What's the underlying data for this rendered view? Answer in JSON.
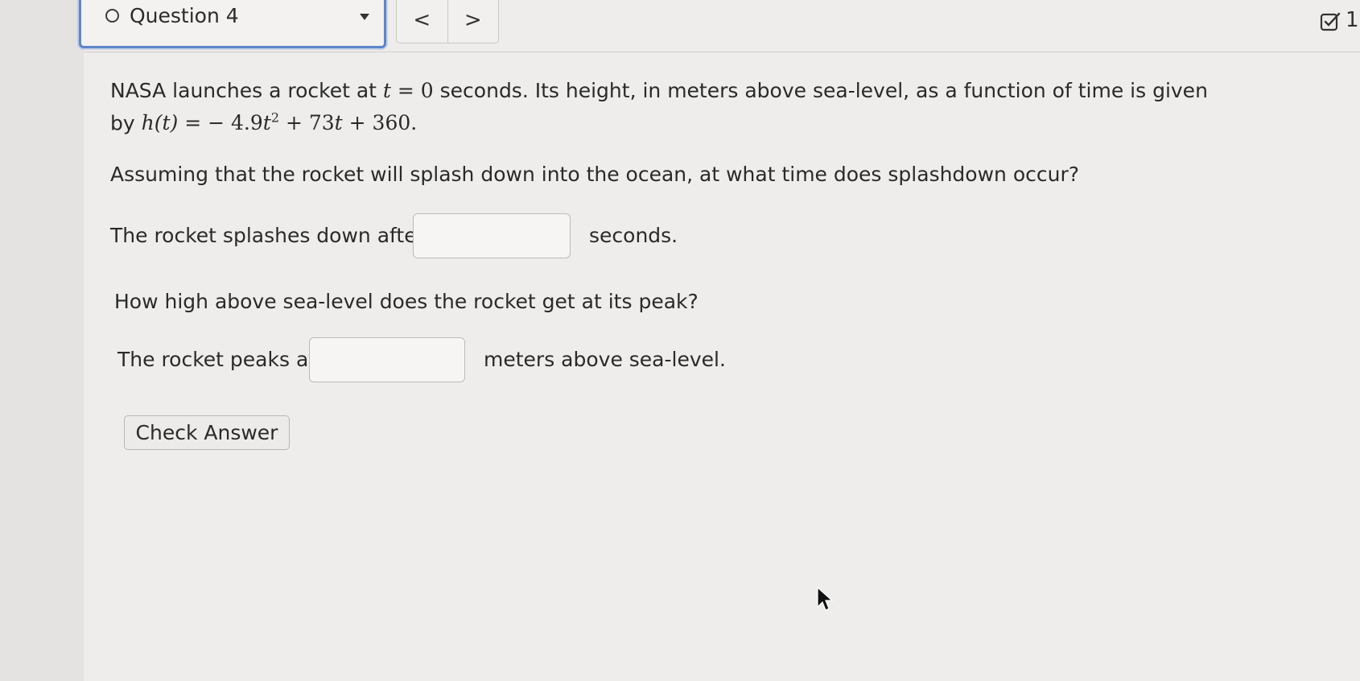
{
  "header": {
    "question_label": "Question 4",
    "prev_glyph": "<",
    "next_glyph": ">",
    "progress_count": "1"
  },
  "problem": {
    "intro_1": "NASA launches a rocket at ",
    "intro_t_var": "t",
    "intro_eq": " = 0",
    "intro_2": " seconds. Its height, in meters above sea-level, as a function of time is given",
    "line2_prefix": "by ",
    "function_lhs": "h(t)",
    "function_eq": " = ",
    "function_rhs_a": " − 4.9",
    "function_rhs_t": "t",
    "function_rhs_exp": "2",
    "function_rhs_b": " + 73",
    "function_rhs_t2": "t",
    "function_rhs_c": " + 360.",
    "question_splash": "Assuming that the rocket will splash down into the ocean, at what time does splashdown occur?",
    "splash_prefix": "The rocket splashes down after",
    "splash_suffix": "seconds.",
    "splash_value": "",
    "question_peak": "How high above sea-level does the rocket get at its peak?",
    "peak_prefix": "The rocket peaks at",
    "peak_suffix": "meters above sea-level.",
    "peak_value": ""
  },
  "actions": {
    "check_answer_label": "Check Answer"
  },
  "icons": {
    "status": "empty-circle-icon",
    "dropdown": "caret-down-icon",
    "progress": "checkbox-edit-icon",
    "cursor": "mouse-pointer-icon"
  },
  "colors": {
    "select_border": "#5c86c8",
    "page_bg": "#eeedeb"
  }
}
